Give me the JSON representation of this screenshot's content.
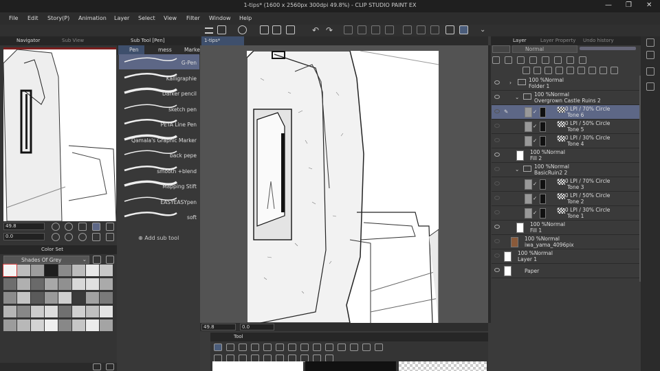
{
  "window": {
    "title": "1-tips* (1600 x 2560px 300dpi 49.8%) - CLIP STUDIO PAINT EX",
    "minimize": "—",
    "maximize": "❐",
    "close": "✕"
  },
  "menu": [
    "File",
    "Edit",
    "Story(P)",
    "Animation",
    "Layer",
    "Select",
    "View",
    "Filter",
    "Window",
    "Help"
  ],
  "navigator": {
    "tab_navigator": "Navigator",
    "tab_subview": "Sub View",
    "zoom": "49.8",
    "rotation": "0.0"
  },
  "subtool": {
    "header": "Sub Tool [Pen]",
    "tabs": [
      "Pen",
      "mess",
      "Marker"
    ],
    "brushes": [
      "G-Pen",
      "Kalligraphie",
      "Darker pencil",
      "sketch pen",
      "PETA Line Pen",
      "Qamala's Graphic Marker",
      "back pepe",
      "smooth +blend",
      "Mapping Stift",
      "EASYEASYpen",
      "soft"
    ],
    "add_label": "Add sub tool"
  },
  "colorset": {
    "tab": "Color Set",
    "set_name": "Shades Of Grey",
    "swatches": [
      "#f5f5f5",
      "#bdbdbd",
      "#9e9e9e",
      "#1e1e1e",
      "#8a8a8a",
      "#bcbcbc",
      "#e8e8e8",
      "#c8c8c8",
      "#6e6e6e",
      "#b0b0b0",
      "#6a6a6a",
      "#a8a8a8",
      "#909090",
      "#d8d8d8",
      "#e0e0e0",
      "#aaaaaa",
      "#8c8c8c",
      "#c4c4c4",
      "#5a5a5a",
      "#9a9a9a",
      "#cfcfcf",
      "#3a3a3a",
      "#a2a2a2",
      "#7a7a7a",
      "#b6b6b6",
      "#888888",
      "#cccccc",
      "#dddddd",
      "#707070",
      "#d0d0d0",
      "#c0c0c0",
      "#e4e4e4",
      "#9c9c9c",
      "#b8b8b8",
      "#d4d4d4",
      "#f0f0f0",
      "#888888",
      "#c6c6c6",
      "#ececec",
      "#a4a4a4"
    ]
  },
  "canvas": {
    "tab": "1-tips*",
    "zoom": "49.8",
    "rotation": "0.0"
  },
  "tool": {
    "tab": "Tool"
  },
  "layers": {
    "tabs": [
      "Layer",
      "Layer Property",
      "Undo history"
    ],
    "blend": "Normal",
    "rows": [
      {
        "pct": "100 %Normal",
        "name": "Folder 1"
      },
      {
        "pct": "100 %Normal",
        "name": "Overgrown Castle Ruins 2"
      },
      {
        "pct": "60.0 LPI / 70% Circle",
        "name": "Tone 6"
      },
      {
        "pct": "60.0 LPI / 50% Circle",
        "name": "Tone 5"
      },
      {
        "pct": "60.0 LPI / 30% Circle",
        "name": "Tone 4"
      },
      {
        "pct": "100 %Normal",
        "name": "Fill 2"
      },
      {
        "pct": "100 %Normal",
        "name": "BasicRuin2 2"
      },
      {
        "pct": "60.0 LPI / 70% Circle",
        "name": "Tone 3"
      },
      {
        "pct": "60.0 LPI / 50% Circle",
        "name": "Tone 2"
      },
      {
        "pct": "60.0 LPI / 30% Circle",
        "name": "Tone 1"
      },
      {
        "pct": "100 %Normal",
        "name": "Fill 1"
      },
      {
        "pct": "100 %Normal",
        "name": "iwa_yama_4096pix"
      },
      {
        "pct": "100 %Normal",
        "name": "Layer 1"
      },
      {
        "pct": "",
        "name": "Paper"
      }
    ]
  },
  "colors": {
    "selected_layer": "#5d6786",
    "panel": "#343434",
    "header": "#262626"
  }
}
